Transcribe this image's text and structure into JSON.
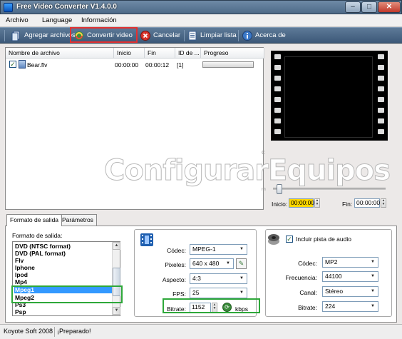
{
  "window": {
    "title": "Free Video Converter V1.4.0.0",
    "min": "–",
    "max": "□",
    "close": "✕"
  },
  "menu": [
    {
      "label": "Archivo"
    },
    {
      "label": "Language"
    },
    {
      "label": "Información"
    }
  ],
  "toolbar": {
    "add_files": "Agregar archivos",
    "convert": "Convertir video",
    "cancel": "Cancelar",
    "clear": "Limpiar lista",
    "about": "Acerca de"
  },
  "file_table": {
    "columns": [
      "Nombre de archivo",
      "Inicio",
      "Fin",
      "ID de ...",
      "Progreso"
    ],
    "rows": [
      {
        "checked": true,
        "name": "Bear.flv",
        "start": "00:00:00",
        "end": "00:00:12",
        "id": "[1]",
        "progress": 0
      }
    ]
  },
  "trim": {
    "start_label": "Inicio:",
    "start_value": "00:00:00",
    "end_label": "Fin:",
    "end_value": "00:00:00"
  },
  "tabs": [
    {
      "label": "Formato de salida"
    },
    {
      "label": "Parámetros"
    }
  ],
  "output": {
    "heading": "Formato de salida:",
    "formats": [
      "DVD (NTSC format)",
      "DVD (PAL format)",
      "Flv",
      "Iphone",
      "Ipod",
      "Mp4",
      "Mpeg1",
      "Mpeg2",
      "Ps3",
      "Psp"
    ],
    "selected": "Mpeg1"
  },
  "video": {
    "codec_label": "Códec:",
    "codec": "MPEG-1",
    "pixels_label": "Pixeles:",
    "pixels": "640 x 480",
    "aspect_label": "Aspecto:",
    "aspect": "4:3",
    "fps_label": "FPS:",
    "fps": "25",
    "bitrate_label": "Bitrate:",
    "bitrate": "1152",
    "bitrate_unit": "kbps"
  },
  "audio": {
    "include_label": "Incluir pista de audio",
    "include_checked": true,
    "codec_label": "Códec:",
    "codec": "MP2",
    "freq_label": "Frecuencia:",
    "freq": "44100",
    "channel_label": "Canal:",
    "channel": "Stéreo",
    "bitrate_label": "Bitrate:",
    "bitrate": "224"
  },
  "status": {
    "company": "Koyote Soft 2008",
    "message": "¡Preparado!"
  },
  "watermark": {
    "text": "ConfigurarEquipos",
    "c": "c",
    "m": "m"
  },
  "colors": {
    "titlebar": "#56728f",
    "selection": "#3399ff",
    "highlight_red": "#e33030",
    "highlight_green": "#2ea83a"
  }
}
